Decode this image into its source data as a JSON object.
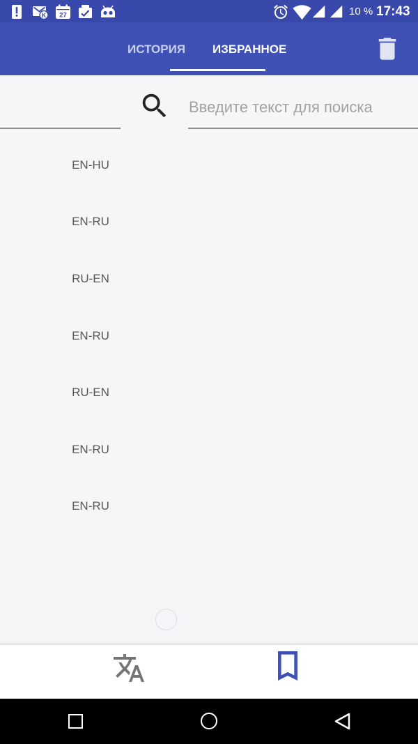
{
  "theme": {
    "status_bar": "#3849AB",
    "primary": "#3F51B5",
    "background": "#F6F6F9",
    "inactive_icon": "#757575",
    "list_text": "#575757"
  },
  "status_bar": {
    "left_icons": [
      "alert-icon",
      "mail-icon",
      "calendar-icon",
      "gallery-icon",
      "android-icon"
    ],
    "mail_badge": "K",
    "calendar_day": "27",
    "right_icons": [
      "alarm-icon",
      "wifi-icon",
      "signal-icon",
      "signal-icon"
    ],
    "battery": "10 %",
    "time": "17:43"
  },
  "toolbar": {
    "tabs": [
      {
        "label": "ИСТОРИЯ",
        "active": false
      },
      {
        "label": "ИЗБРАННОЕ",
        "active": true
      }
    ],
    "action_icon": "trash-icon"
  },
  "search": {
    "icon": "search-icon",
    "placeholder": "Введите текст для поиска",
    "value": ""
  },
  "favorites": {
    "items": [
      "EN-HU",
      "EN-RU",
      "RU-EN",
      "EN-RU",
      "RU-EN",
      "EN-RU",
      "EN-RU"
    ]
  },
  "bottom_nav": {
    "items": [
      {
        "icon": "translate-icon",
        "active": false
      },
      {
        "icon": "bookmark-icon",
        "active": true
      }
    ]
  },
  "system_nav": {
    "buttons": [
      "recents-icon",
      "home-icon",
      "back-icon"
    ]
  }
}
